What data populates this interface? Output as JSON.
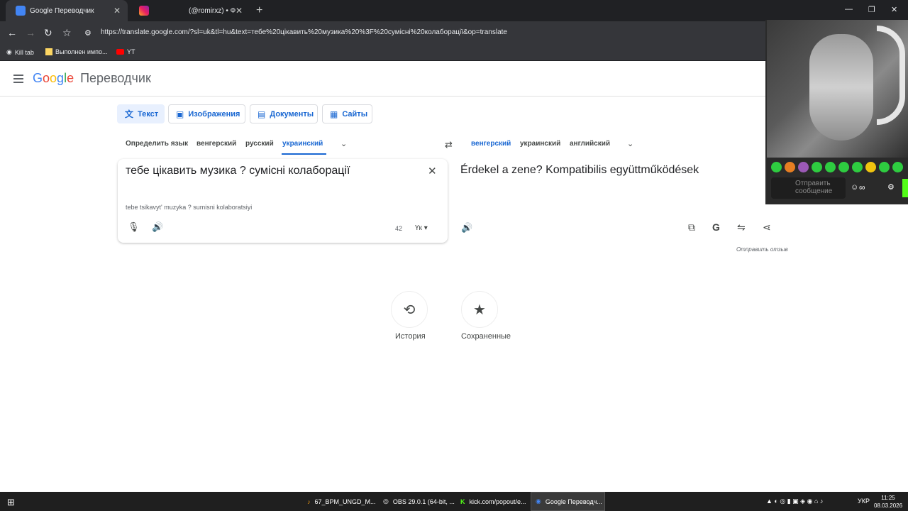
{
  "browser": {
    "tabs": [
      {
        "title": "Google Переводчик",
        "close": "✕"
      },
      {
        "title": "(@romirxz) • Фото",
        "close": "✕"
      }
    ],
    "new_tab": "+",
    "url": "https://translate.google.com/?sl=uk&tl=hu&text=тебе%20цікавить%20музика%20%3F%20сумісні%20колаборації&op=translate",
    "bookmarks": [
      "Kill tab",
      "Выполнен импо...",
      "YT"
    ],
    "window_controls": [
      "—",
      "❐",
      "✕"
    ]
  },
  "header": {
    "logo_letters": [
      "G",
      "o",
      "o",
      "g",
      "l",
      "e"
    ],
    "product": "Переводчик"
  },
  "modes": [
    "Текст",
    "Изображения",
    "Документы",
    "Сайты"
  ],
  "source_langs": [
    "Определить язык",
    "венгерский",
    "русский",
    "украинский"
  ],
  "target_langs": [
    "венгерский",
    "украинский",
    "английский"
  ],
  "source": {
    "text": "тебе цікавить музика ? сумісні колаборації",
    "transliteration": "tebe tsikavytʹ muzyka ? sumisni kolaboratsiyi",
    "char_count": "42",
    "keyboard": "Үк"
  },
  "target": {
    "text": "Érdekel a zene? Kompatibilis együttműködések"
  },
  "feedback": "Отправить отзыв",
  "bottom": {
    "history": "История",
    "saved": "Сохраненные"
  },
  "stream": {
    "chat_placeholder": "Отправить сообщение"
  },
  "taskbar": {
    "items": [
      "67_BPM_UNGD_M...",
      "OBS 29.0.1 (64-bit, ...",
      "kick.com/popout/e...",
      "Google Переводч..."
    ],
    "lang": "УКР",
    "time": "11:25",
    "date": "08.03.2026"
  },
  "colors": {
    "accent": "#1967d2",
    "google_blue": "#4285f4",
    "google_red": "#ea4335",
    "google_yellow": "#fbbc05",
    "google_green": "#34a853"
  }
}
